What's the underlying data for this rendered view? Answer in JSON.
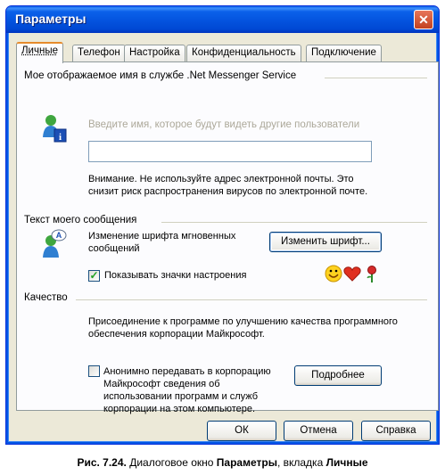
{
  "window": {
    "title": "Параметры",
    "close_glyph": "✕"
  },
  "tabs": [
    {
      "label": "Личные",
      "active": true
    },
    {
      "label": "Телефон",
      "active": false
    },
    {
      "label": "Настройка",
      "active": false
    },
    {
      "label": "Конфиденциальность",
      "active": false
    },
    {
      "label": "Подключение",
      "active": false
    }
  ],
  "display_name": {
    "heading": "Мое отображаемое имя в службе .Net Messenger Service",
    "placeholder": "Введите имя, которое будут видеть другие пользователи",
    "value": "",
    "note": "Внимание. Не используйте адрес электронной почты. Это снизит риск распространения вирусов по электронной почте."
  },
  "message_text": {
    "heading": "Текст моего сообщения",
    "font_label": "Изменение шрифта мгновенных сообщений",
    "change_font_button": "Изменить шрифт...",
    "show_emoticons_label": "Показывать значки настроения",
    "show_emoticons_checked": true,
    "emoticons": [
      "smiley",
      "heart",
      "rose"
    ]
  },
  "quality": {
    "heading": "Качество",
    "description": "Присоединение к программе по улучшению качества программного обеспечения корпорации Майкрософт.",
    "anon_label": "Анонимно передавать в корпорацию Майкрософт сведения об использовании программ и служб корпорации на этом компьютере.",
    "anon_checked": false,
    "more_button": "Подробнее"
  },
  "footer": {
    "ok": "ОК",
    "cancel": "Отмена",
    "help": "Справка"
  },
  "caption": {
    "prefix": "Рис. 7.24.",
    "text1": " Диалоговое окно ",
    "bold1": "Параметры",
    "text2": ", вкладка ",
    "bold2": "Личные"
  },
  "colors": {
    "titlebar": "#0453de",
    "dialog_bg": "#ece9d8",
    "active_tab_accent": "#e68b2c",
    "check_mark": "#21a121"
  }
}
